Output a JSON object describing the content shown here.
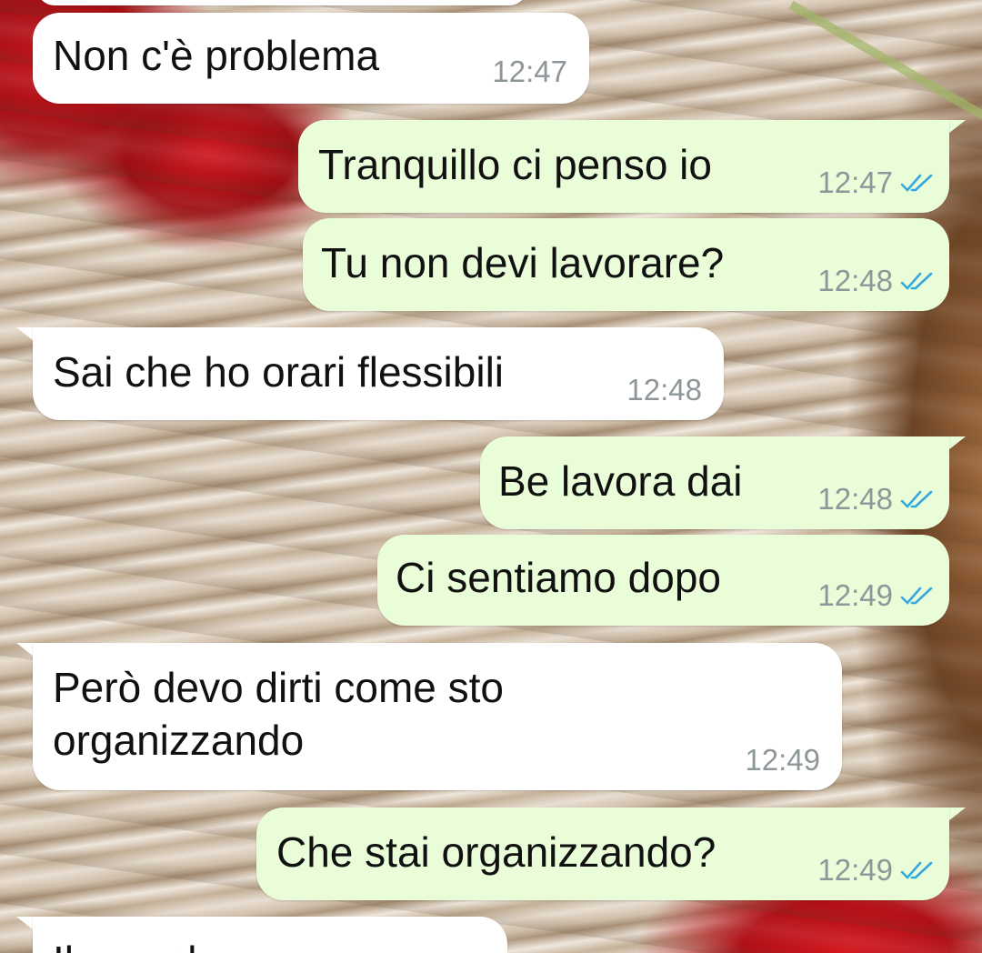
{
  "chat": {
    "messages": [
      {
        "direction": "in",
        "text": "Non c'è problema",
        "time": "12:47"
      },
      {
        "direction": "out",
        "text": "Tranquillo ci penso io",
        "time": "12:47",
        "status": "read-ticks-icon"
      },
      {
        "direction": "out",
        "text": "Tu non devi lavorare?",
        "time": "12:48",
        "status": "read-ticks-icon"
      },
      {
        "direction": "in",
        "text": "Sai che ho orari flessibili",
        "time": "12:48"
      },
      {
        "direction": "out",
        "text": "Be lavora dai",
        "time": "12:48",
        "status": "read-ticks-icon"
      },
      {
        "direction": "out",
        "text": "Ci sentiamo dopo",
        "time": "12:49",
        "status": "read-ticks-icon"
      },
      {
        "direction": "in",
        "text": "Però devo dirti come sto\norganizzando",
        "time": "12:49"
      },
      {
        "direction": "out",
        "text": "Che stai organizzando?",
        "time": "12:49",
        "status": "read-ticks-icon"
      },
      {
        "direction": "in",
        "text": "Il compleanno",
        "time": ""
      }
    ]
  },
  "colors": {
    "incoming_bubble": "#ffffff",
    "outgoing_bubble": "#e9fdd8",
    "read_ticks": "#35a8e0",
    "timestamp": "#8e969a"
  }
}
